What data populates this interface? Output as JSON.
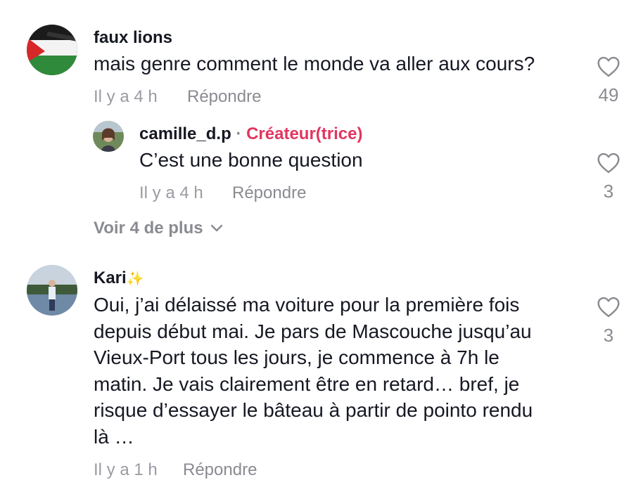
{
  "comments": [
    {
      "username": "faux lions",
      "text": "mais genre comment le monde va aller aux cours?",
      "time": "Il y a 4 h",
      "reply": "Répondre",
      "likes": "49"
    },
    {
      "username": "Kari",
      "username_emoji": "✨",
      "lines": [
        "Oui, j’ai délaissé ma voiture pour la première fois",
        "depuis début mai. Je pars de Mascouche jusqu’au",
        "Vieux-Port tous les jours, je commence à 7h le",
        "matin. Je vais clairement être en retard… bref, je",
        "risque d’essayer le bâteau à partir de pointo rendu",
        "là …"
      ],
      "time": "Il y a 1 h",
      "reply": "Répondre",
      "likes": "3"
    }
  ],
  "reply_thread": {
    "username": "camille_d.p",
    "separator": "·",
    "badge": "Créateur(trice)",
    "text": "C’est une bonne question",
    "time": "Il y a 4 h",
    "reply": "Répondre",
    "likes": "3"
  },
  "view_more": "Voir 4 de plus",
  "icons": {
    "like": "heart-outline-icon",
    "expand": "chevron-down-icon"
  },
  "colors": {
    "creator_badge": "#e2355f",
    "muted": "#8a8b91"
  }
}
